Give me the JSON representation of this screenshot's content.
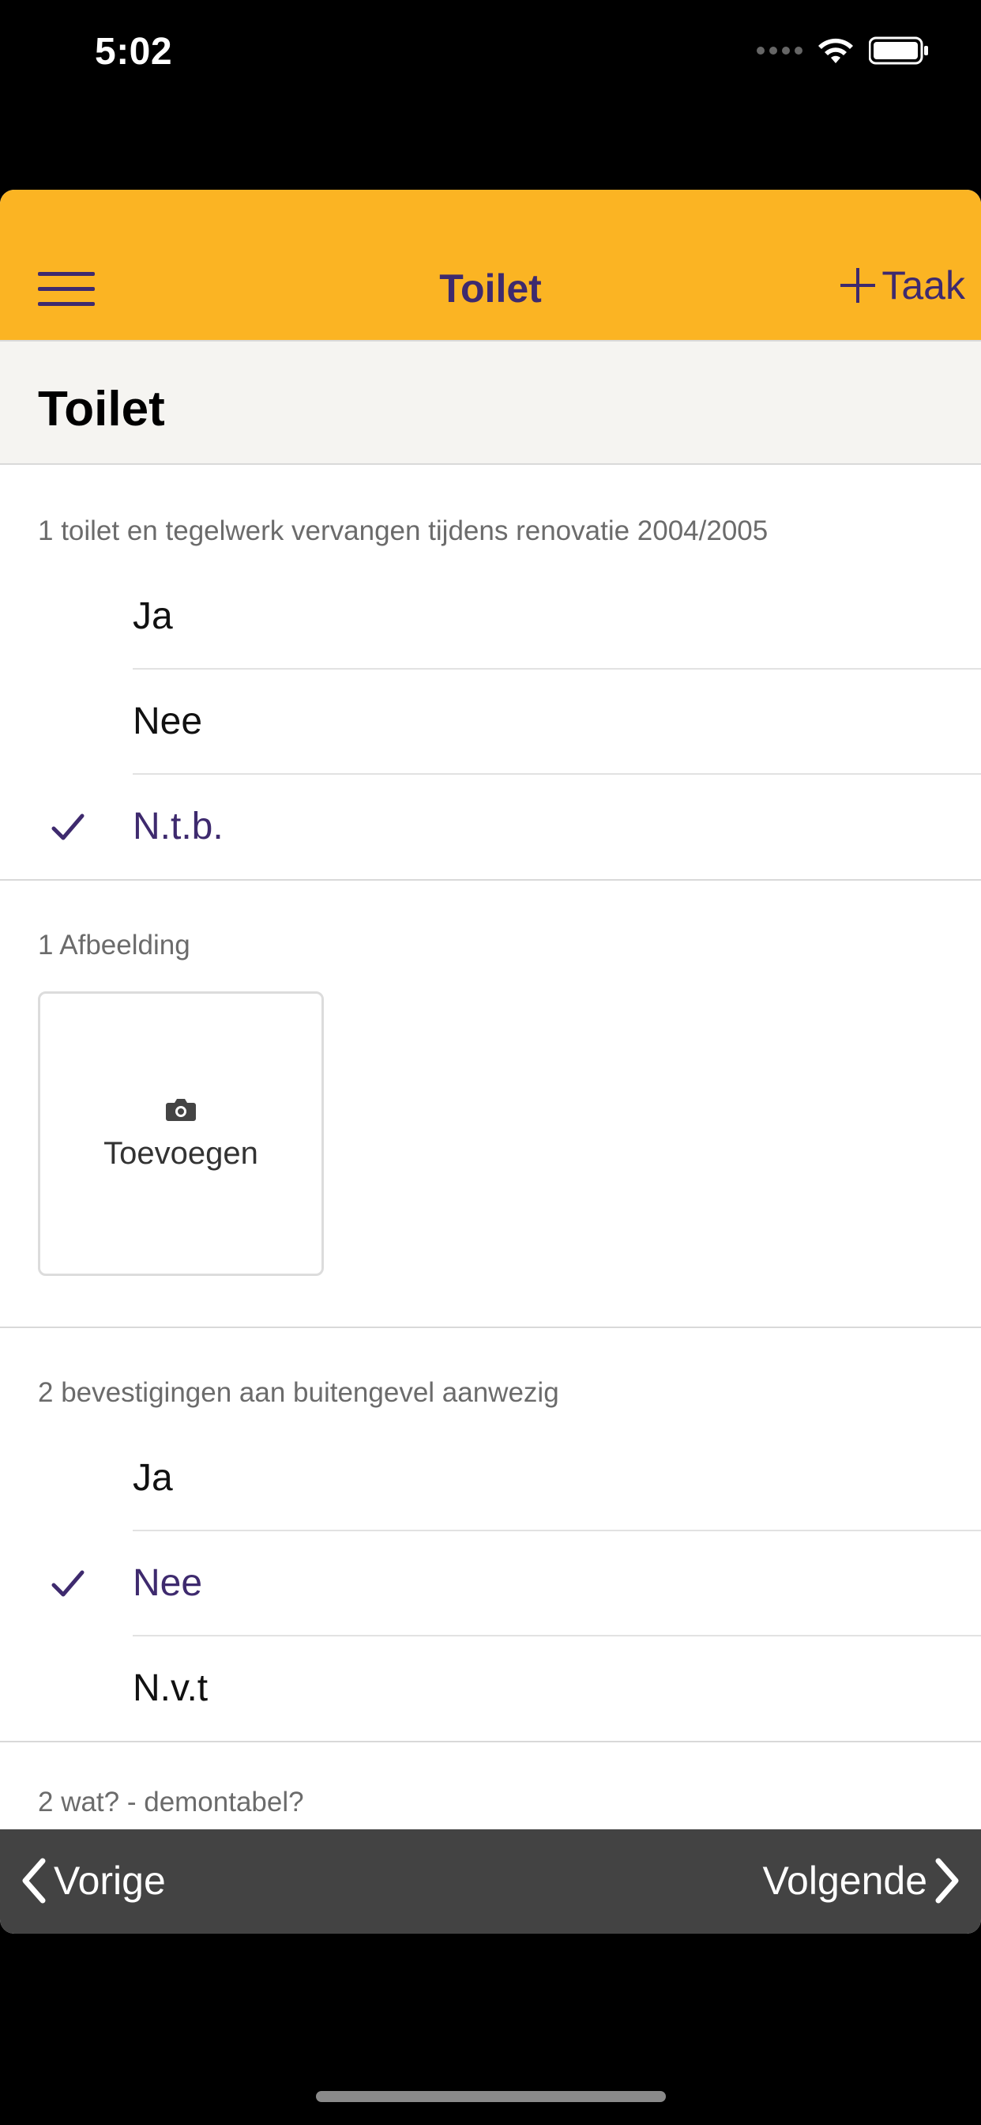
{
  "status_bar": {
    "time": "5:02"
  },
  "nav": {
    "title": "Toilet",
    "add_label": "Taak"
  },
  "page": {
    "title": "Toilet"
  },
  "questions": [
    {
      "text": "1 toilet en tegelwerk vervangen tijdens renovatie 2004/2005",
      "options": [
        "Ja",
        "Nee",
        "N.t.b."
      ],
      "selected": "N.t.b."
    },
    {
      "text": "1 Afbeelding",
      "add_photo_label": "Toevoegen"
    },
    {
      "text": "2 bevestigingen aan buitengevel aanwezig",
      "options": [
        "Ja",
        "Nee",
        "N.v.t"
      ],
      "selected": "Nee"
    },
    {
      "text": "2 wat? - demontabel?"
    }
  ],
  "bottom_bar": {
    "prev_label": "Vorige",
    "next_label": "Volgende"
  },
  "colors": {
    "accent": "#fbb423",
    "brand": "#3e2a6e",
    "bottom_bar": "#434343"
  }
}
